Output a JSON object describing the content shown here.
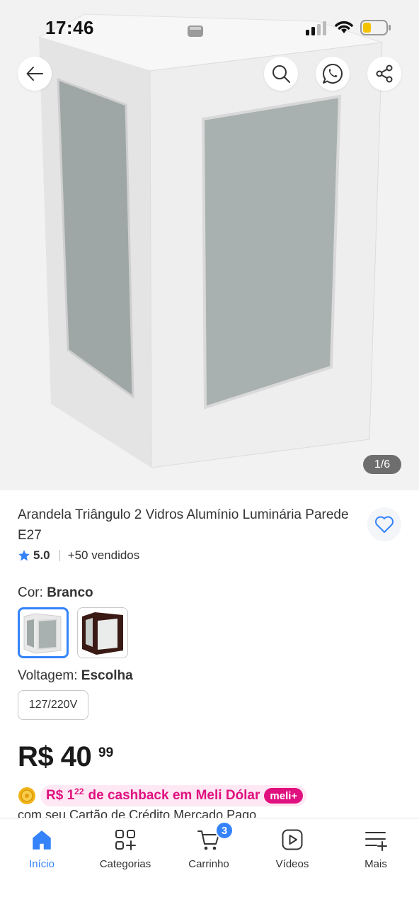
{
  "status_bar": {
    "time": "17:46"
  },
  "gallery": {
    "counter": "1/6"
  },
  "product": {
    "title": "Arandela Triângulo 2 Vidros Alumínio Luminária Parede E27",
    "rating": "5.0",
    "sold": "+50 vendidos"
  },
  "color_option": {
    "label": "Cor:",
    "value": "Branco",
    "swatches": [
      "white",
      "brown"
    ]
  },
  "voltage_option": {
    "label": "Voltagem:",
    "value": "Escolha",
    "choice": "127/220V"
  },
  "price": {
    "currency": "R$",
    "whole": "40",
    "cents": "99"
  },
  "cashback": {
    "amount_prefix": "R$ 1",
    "amount_cents": "22",
    "text": "de cashback em Meli Dólar",
    "badge": "meli+",
    "subline": "com seu Cartão de Crédito Mercado Pago"
  },
  "bottom_nav": {
    "items": [
      {
        "label": "Início",
        "icon": "home-icon",
        "active": true
      },
      {
        "label": "Categorias",
        "icon": "categories-icon",
        "active": false
      },
      {
        "label": "Carrinho",
        "icon": "cart-icon",
        "active": false,
        "badge": "3"
      },
      {
        "label": "Vídeos",
        "icon": "video-icon",
        "active": false
      },
      {
        "label": "Mais",
        "icon": "menu-plus-icon",
        "active": false
      }
    ]
  },
  "colors": {
    "accent": "#3483fa",
    "cashback": "#e0107f",
    "cashback_bg": "#fde8f3"
  }
}
